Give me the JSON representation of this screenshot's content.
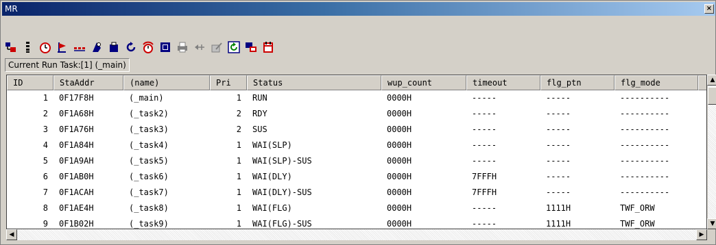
{
  "window": {
    "title": "MR",
    "close_glyph": "×"
  },
  "toolbar": {
    "icons": [
      "task-view-icon",
      "sort-icon",
      "timer-icon",
      "flag-icon",
      "mailbox-icon",
      "run-icon",
      "memory-pool-icon",
      "cycle-icon",
      "alarm-icon",
      "box-icon",
      "printer-icon",
      "arrow-icon",
      "edit-icon",
      "refresh-icon",
      "monitor-icon",
      "calendar-icon"
    ]
  },
  "run_task": {
    "label": "Current Run Task:[1] (_main)"
  },
  "table": {
    "columns": [
      "ID",
      "StaAddr",
      "(name)",
      "Pri",
      "Status",
      "wup_count",
      "timeout",
      "flg_ptn",
      "flg_mode"
    ],
    "rows": [
      [
        "1",
        "0F17F8H",
        "(_main)",
        "1",
        "RUN",
        "0000H",
        "-----",
        "-----",
        "----------"
      ],
      [
        "2",
        "0F1A68H",
        "(_task2)",
        "2",
        "RDY",
        "0000H",
        "-----",
        "-----",
        "----------"
      ],
      [
        "3",
        "0F1A76H",
        "(_task3)",
        "2",
        "SUS",
        "0000H",
        "-----",
        "-----",
        "----------"
      ],
      [
        "4",
        "0F1A84H",
        "(_task4)",
        "1",
        "WAI(SLP)",
        "0000H",
        "-----",
        "-----",
        "----------"
      ],
      [
        "5",
        "0F1A9AH",
        "(_task5)",
        "1",
        "WAI(SLP)-SUS",
        "0000H",
        "-----",
        "-----",
        "----------"
      ],
      [
        "6",
        "0F1AB0H",
        "(_task6)",
        "1",
        "WAI(DLY)",
        "0000H",
        "7FFFH",
        "-----",
        "----------"
      ],
      [
        "7",
        "0F1ACAH",
        "(_task7)",
        "1",
        "WAI(DLY)-SUS",
        "0000H",
        "7FFFH",
        "-----",
        "----------"
      ],
      [
        "8",
        "0F1AE4H",
        "(_task8)",
        "1",
        "WAI(FLG)",
        "0000H",
        "-----",
        "1111H",
        "TWF_ORW"
      ],
      [
        "9",
        "0F1B02H",
        "(_task9)",
        "1",
        "WAI(FLG)-SUS",
        "0000H",
        "-----",
        "1111H",
        "TWF_ORW"
      ]
    ]
  },
  "scroll": {
    "up": "▲",
    "down": "▼",
    "left": "◀",
    "right": "▶"
  }
}
